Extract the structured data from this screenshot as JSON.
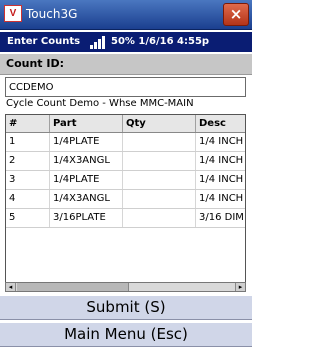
{
  "app": {
    "logo_text": "V",
    "title": "Touch3G",
    "close_label": "×"
  },
  "status": {
    "text": "Enter Counts",
    "battery": "50%",
    "date": "1/6/16",
    "time": "4:55p",
    "signal_icon": "signal-bars-icon"
  },
  "form": {
    "count_id_label": "Count ID:",
    "count_id_value": "CCDEMO",
    "subtitle": "Cycle Count Demo - Whse MMC-MAIN"
  },
  "grid": {
    "columns": [
      "#",
      "Part",
      "Qty",
      "Desc"
    ],
    "rows": [
      {
        "num": "1",
        "part": "1/4PLATE",
        "qty": "",
        "desc": "1/4 INCH"
      },
      {
        "num": "2",
        "part": "1/4X3ANGL",
        "qty": "",
        "desc": "1/4 INCH"
      },
      {
        "num": "3",
        "part": "1/4PLATE",
        "qty": "",
        "desc": "1/4 INCH"
      },
      {
        "num": "4",
        "part": "1/4X3ANGL",
        "qty": "",
        "desc": "1/4 INCH"
      },
      {
        "num": "5",
        "part": "3/16PLATE",
        "qty": "",
        "desc": "3/16 DIM"
      }
    ]
  },
  "buttons": {
    "submit": "Submit (S)",
    "main_menu": "Main Menu (Esc)"
  }
}
